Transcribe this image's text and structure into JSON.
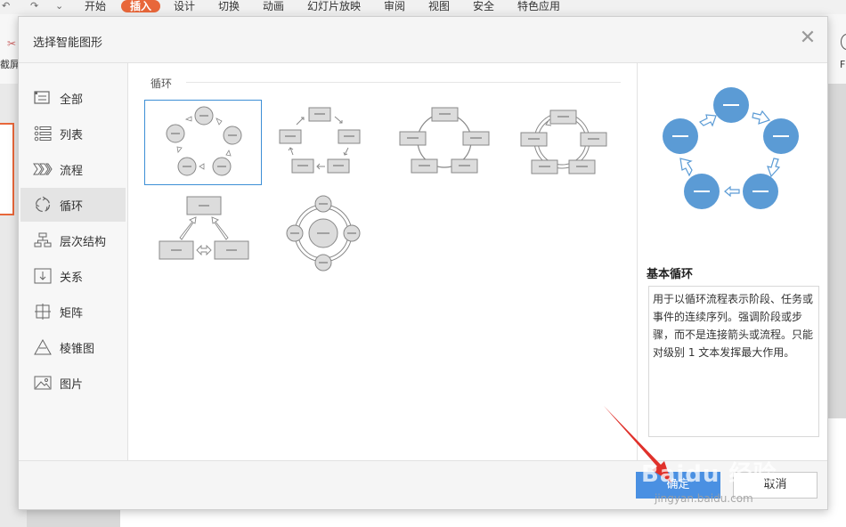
{
  "app": {
    "quick_access": [
      "↶",
      "↷",
      "⌄"
    ],
    "tabs": [
      "开始",
      "插入",
      "设计",
      "切换",
      "动画",
      "幻灯片放映",
      "审阅",
      "视图",
      "安全",
      "特色应用"
    ],
    "active_tab": "插入",
    "left_label": "截屏",
    "right_label": "F"
  },
  "dialog": {
    "title": "选择智能图形",
    "close_glyph": "✕",
    "sidebar": [
      {
        "label": "全部",
        "icon": "all-icon"
      },
      {
        "label": "列表",
        "icon": "list-icon"
      },
      {
        "label": "流程",
        "icon": "process-icon"
      },
      {
        "label": "循环",
        "icon": "cycle-icon",
        "active": true
      },
      {
        "label": "层次结构",
        "icon": "hierarchy-icon"
      },
      {
        "label": "关系",
        "icon": "relationship-icon"
      },
      {
        "label": "矩阵",
        "icon": "matrix-icon"
      },
      {
        "label": "棱锥图",
        "icon": "pyramid-icon"
      },
      {
        "label": "图片",
        "icon": "picture-icon"
      }
    ],
    "section_label": "循环",
    "thumbnails": [
      {
        "name": "basic-cycle",
        "selected": true
      },
      {
        "name": "text-cycle"
      },
      {
        "name": "block-cycle"
      },
      {
        "name": "continuous-cycle"
      },
      {
        "name": "opposing-arrows"
      },
      {
        "name": "radial-cycle"
      }
    ],
    "preview": {
      "title": "基本循环",
      "description": "用于以循环流程表示阶段、任务或事件的连续序列。强调阶段或步骤，而不是连接箭头或流程。只能对级别 1 文本发挥最大作用。",
      "node_color": "#5b9bd5"
    },
    "buttons": {
      "ok": "确定",
      "cancel": "取消"
    }
  },
  "watermark": {
    "brand": "Baidu 经验",
    "url": "jingyan.baidu.com"
  },
  "colors": {
    "accent": "#e8673a",
    "primary_button": "#4a90e2",
    "selection_border": "#3d8fd6"
  }
}
